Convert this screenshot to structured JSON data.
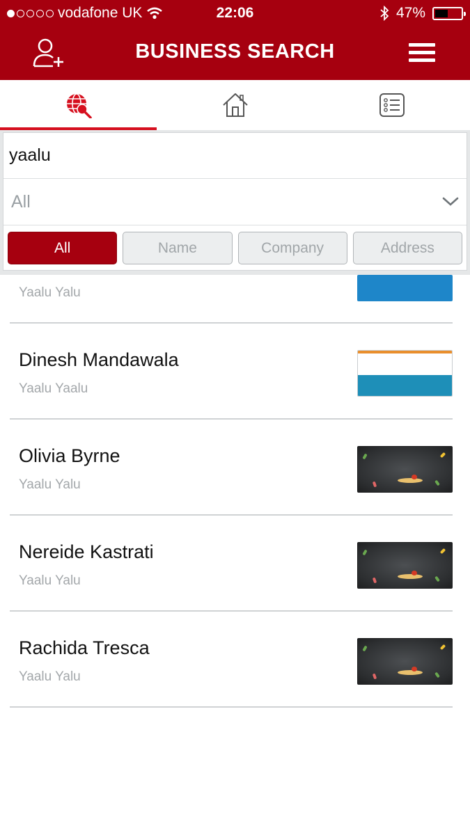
{
  "status_bar": {
    "carrier": "vodafone UK",
    "time": "22:06",
    "battery_percent": "47%",
    "battery_level": 0.47,
    "signal_dots_filled": 1,
    "signal_dots_total": 5
  },
  "nav": {
    "title": "BUSINESS SEARCH",
    "left_icon": "add-user-icon",
    "right_icon": "hamburger-menu-icon"
  },
  "tabs": [
    {
      "icon": "globe-search-icon",
      "active": true
    },
    {
      "icon": "home-icon",
      "active": false
    },
    {
      "icon": "list-icon",
      "active": false
    }
  ],
  "search": {
    "query": "yaalu",
    "category": "All",
    "filters": [
      "All",
      "Name",
      "Company",
      "Address"
    ],
    "active_filter": "All"
  },
  "results": [
    {
      "name": "",
      "subtitle": "Yaalu Yalu",
      "thumbnail": "blue-banner"
    },
    {
      "name": "Dinesh Mandawala",
      "subtitle": "Yaalu Yaalu",
      "thumbnail": "orange-white-blue-stripes"
    },
    {
      "name": "Olivia Byrne",
      "subtitle": "Yaalu Yalu",
      "thumbnail": "chalkboard-food"
    },
    {
      "name": "Nereide Kastrati",
      "subtitle": "Yaalu Yalu",
      "thumbnail": "chalkboard-food"
    },
    {
      "name": "Rachida Tresca",
      "subtitle": "Yaalu Yalu",
      "thumbnail": "chalkboard-food"
    }
  ],
  "colors": {
    "brand_red": "#a6000f",
    "tab_indicator": "#d6101f",
    "divider": "#cfd2d4"
  }
}
